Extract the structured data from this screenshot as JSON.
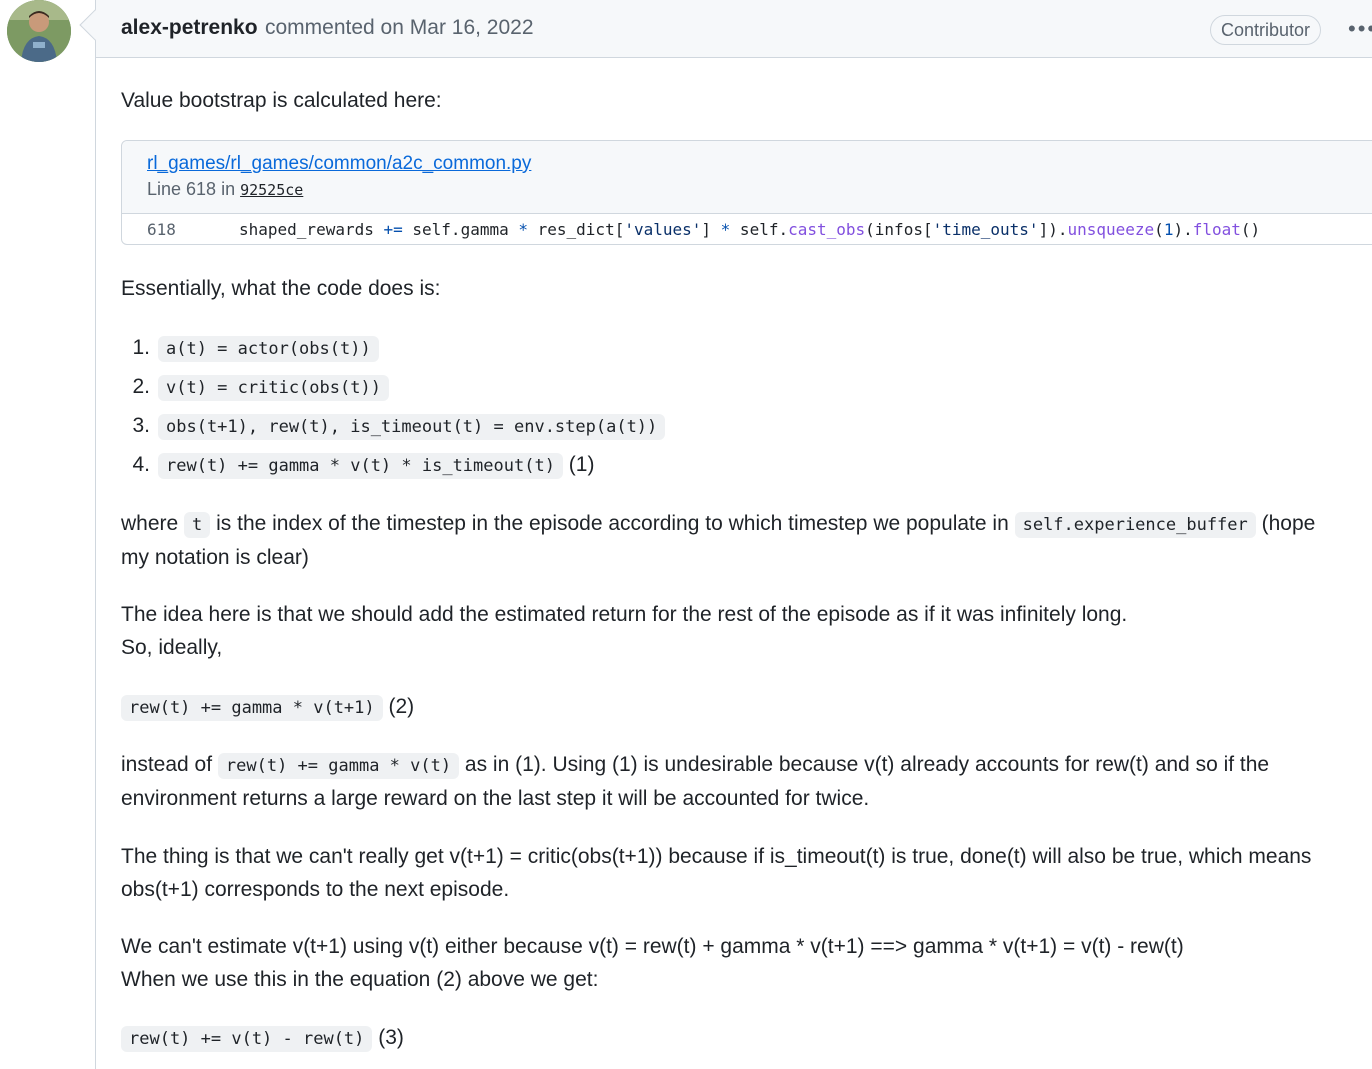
{
  "header": {
    "author": "alex-petrenko",
    "action": "commented on",
    "date": "Mar 16, 2022",
    "badge": "Contributor",
    "menu_glyph": "•••"
  },
  "body": {
    "p1": "Value bootstrap is calculated here:",
    "embed": {
      "file_link": "rl_games/rl_games/common/a2c_common.py",
      "line_prefix": "Line 618 in",
      "sha": "92525ce",
      "line_number": "618",
      "code_parts": {
        "a": "shaped_rewards ",
        "b": "+=",
        "c": " self.gamma ",
        "d": "*",
        "e": " res_dict[",
        "f": "'values'",
        "g": "] ",
        "h": "*",
        "i": " self.",
        "j": "cast_obs",
        "k": "(infos[",
        "l": "'time_outs'",
        "m": "]).",
        "n": "unsqueeze",
        "o": "(",
        "p": "1",
        "q": ").",
        "r": "float",
        "s": "()"
      }
    },
    "p2": "Essentially, what the code does is:",
    "list": [
      {
        "num": "1.",
        "code": "a(t) = actor(obs(t))",
        "suffix": ""
      },
      {
        "num": "2.",
        "code": "v(t) = critic(obs(t))",
        "suffix": ""
      },
      {
        "num": "3.",
        "code": "obs(t+1), rew(t), is_timeout(t) = env.step(a(t))",
        "suffix": ""
      },
      {
        "num": "4.",
        "code": "rew(t) += gamma * v(t) * is_timeout(t)",
        "suffix": "(1)"
      }
    ],
    "p3": {
      "a": "where ",
      "code1": "t",
      "b": " is the index of the timestep in the episode according to which timestep we populate in ",
      "code2": "self.experience_buffer",
      "c": " (hope",
      "d": "my notation is clear)"
    },
    "p4": {
      "line1": "The idea here is that we should add the estimated return for the rest of the episode as if it was infinitely long.",
      "line2": "So, ideally,"
    },
    "eq2": {
      "code": "rew(t) += gamma * v(t+1)",
      "suffix": "(2)"
    },
    "p5": {
      "a": "instead of ",
      "code": "rew(t) += gamma * v(t)",
      "b": " as in (1). Using (1) is undesirable because v(t) already accounts for rew(t) and so if the",
      "line2": "environment returns a large reward on the last step it will be accounted for twice."
    },
    "p6": {
      "line1": "The thing is that we can't really get v(t+1) = critic(obs(t+1)) because if is_timeout(t) is true, done(t) will also be true, which means",
      "line2": "obs(t+1) corresponds to the next episode."
    },
    "p7": {
      "line1": "We can't estimate v(t+1) using v(t) either because v(t) = rew(t) + gamma * v(t+1) ==> gamma * v(t+1) = v(t) - rew(t)",
      "line2": "When we use this in the equation (2) above we get:"
    },
    "eq3": {
      "code": "rew(t) += v(t) - rew(t)",
      "suffix": "(3)"
    }
  }
}
